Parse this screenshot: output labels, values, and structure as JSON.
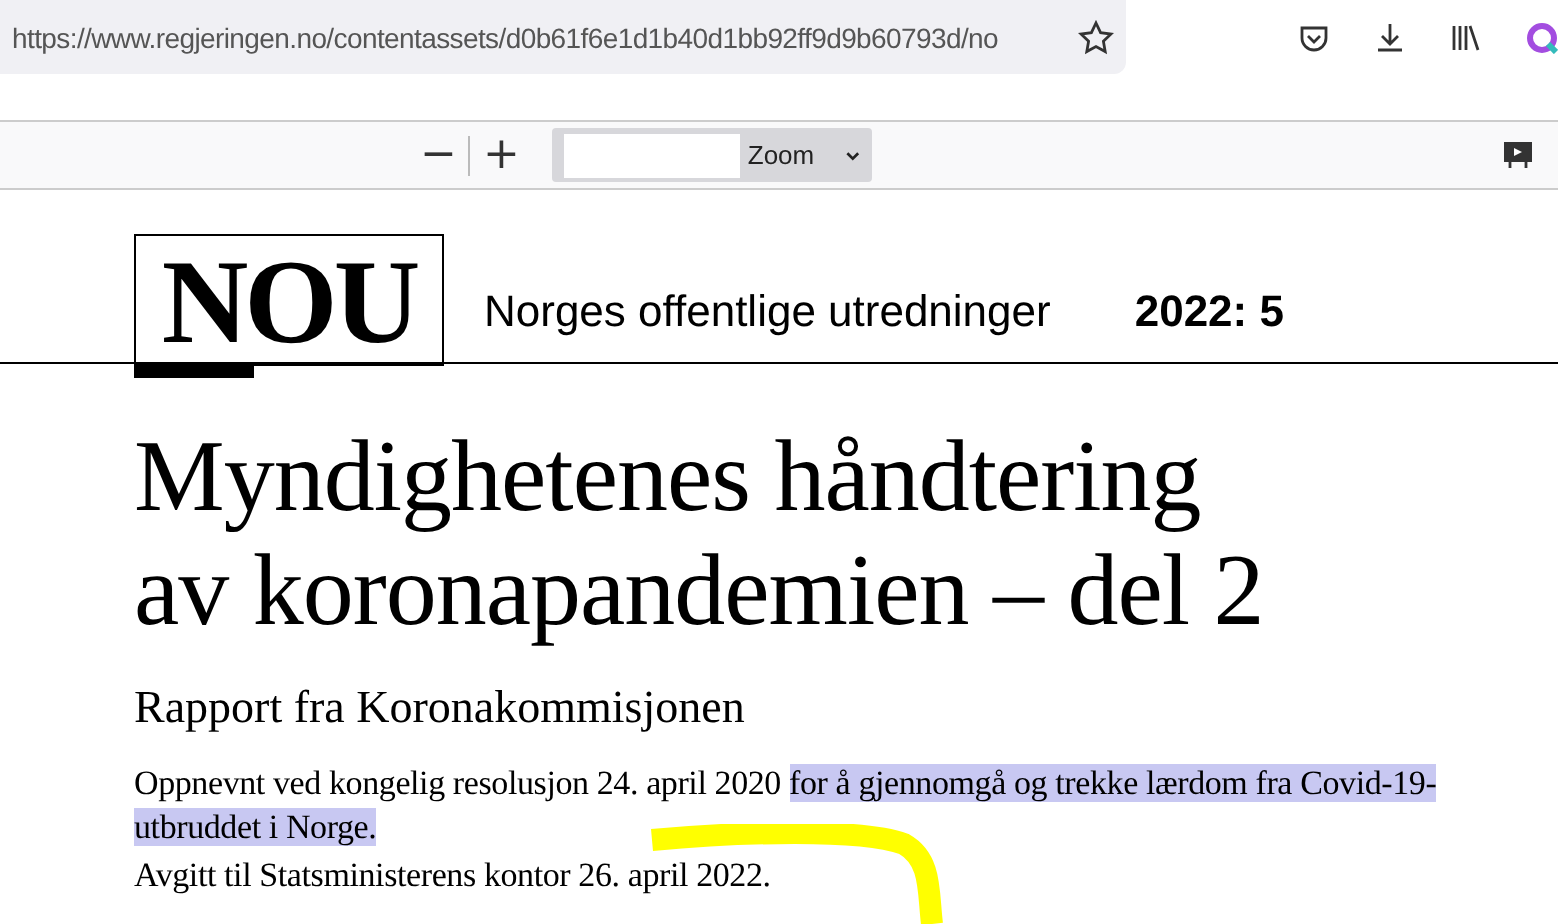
{
  "browser": {
    "url": "https://www.regjeringen.no/contentassets/d0b61f6e1d1b40d1bb92ff9d9b60793d/no"
  },
  "pdf_toolbar": {
    "zoom_out": "−",
    "zoom_in": "+",
    "zoom_label": "Zoom"
  },
  "document": {
    "logo": "NOU",
    "series": "Norges offentlige utredninger",
    "number": "2022: 5",
    "title_lines": [
      "Myndighetenes håndtering",
      "av koronapandemien – del 2"
    ],
    "subtitle": "Rapport fra Koronakommisjonen",
    "paragraphs": [
      {
        "text": "Oppnevnt ved kongelig resolusjon 24. april 2020 ",
        "highlighted": "for å gjennomgå og trekke lærdom fra Covid-19-utbruddet i Norge."
      },
      {
        "text": "Avgitt til Statsministerens kontor 26. april 2022."
      }
    ]
  }
}
